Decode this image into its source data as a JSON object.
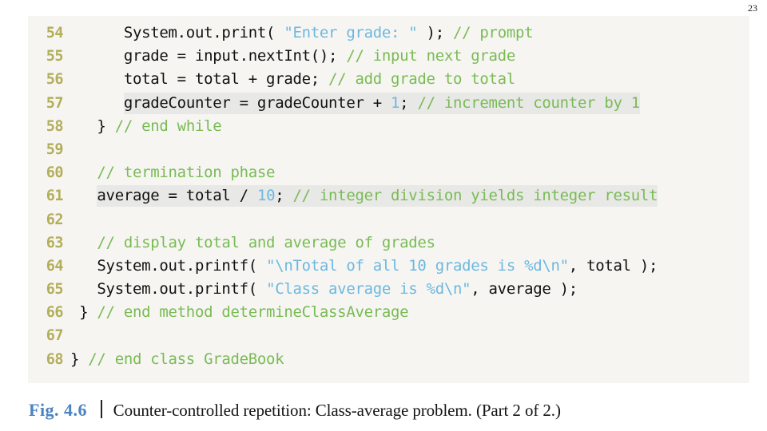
{
  "page": {
    "number": "23"
  },
  "code_listing": {
    "language": "java",
    "lines": [
      {
        "number": "54",
        "highlighted": false,
        "text": "      System.out.print( \"Enter grade: \" ); // prompt",
        "tokens": [
          {
            "type": "plain",
            "text": "      System.out.print( "
          },
          {
            "type": "string",
            "text": "\"Enter grade: \""
          },
          {
            "type": "plain",
            "text": " ); "
          },
          {
            "type": "comment",
            "text": "// prompt"
          }
        ]
      },
      {
        "number": "55",
        "highlighted": false,
        "text": "      grade = input.nextInt(); // input next grade",
        "tokens": [
          {
            "type": "plain",
            "text": "      grade = input.nextInt(); "
          },
          {
            "type": "comment",
            "text": "// input next grade"
          }
        ]
      },
      {
        "number": "56",
        "highlighted": false,
        "text": "      total = total + grade; // add grade to total",
        "tokens": [
          {
            "type": "plain",
            "text": "      total = total + grade; "
          },
          {
            "type": "comment",
            "text": "// add grade to total"
          }
        ]
      },
      {
        "number": "57",
        "highlighted": true,
        "highlight_start": 6,
        "text": "      gradeCounter = gradeCounter + 1; // increment counter by 1",
        "tokens": [
          {
            "type": "plain",
            "text": "      "
          },
          {
            "type": "plain",
            "text": "gradeCounter = gradeCounter + ",
            "hl": true
          },
          {
            "type": "number",
            "text": "1",
            "hl": true
          },
          {
            "type": "plain",
            "text": "; ",
            "hl": true
          },
          {
            "type": "comment",
            "text": "// increment counter by 1",
            "hl": true
          }
        ]
      },
      {
        "number": "58",
        "highlighted": false,
        "text": "   } // end while",
        "tokens": [
          {
            "type": "plain",
            "text": "   } "
          },
          {
            "type": "comment",
            "text": "// end while"
          }
        ]
      },
      {
        "number": "59",
        "highlighted": false,
        "text": "",
        "tokens": []
      },
      {
        "number": "60",
        "highlighted": false,
        "text": "   // termination phase",
        "tokens": [
          {
            "type": "plain",
            "text": "   "
          },
          {
            "type": "comment",
            "text": "// termination phase"
          }
        ]
      },
      {
        "number": "61",
        "highlighted": true,
        "highlight_start": 3,
        "text": "   average = total / 10; // integer division yields integer result",
        "tokens": [
          {
            "type": "plain",
            "text": "   "
          },
          {
            "type": "plain",
            "text": "average = total / ",
            "hl": true
          },
          {
            "type": "number",
            "text": "10",
            "hl": true
          },
          {
            "type": "plain",
            "text": "; ",
            "hl": true
          },
          {
            "type": "comment",
            "text": "// integer division yields integer result",
            "hl": true
          }
        ]
      },
      {
        "number": "62",
        "highlighted": false,
        "text": "",
        "tokens": []
      },
      {
        "number": "63",
        "highlighted": false,
        "text": "   // display total and average of grades",
        "tokens": [
          {
            "type": "plain",
            "text": "   "
          },
          {
            "type": "comment",
            "text": "// display total and average of grades"
          }
        ]
      },
      {
        "number": "64",
        "highlighted": false,
        "text": "   System.out.printf( \"\\nTotal of all 10 grades is %d\\n\", total );",
        "tokens": [
          {
            "type": "plain",
            "text": "   System.out.printf( "
          },
          {
            "type": "string",
            "text": "\"\\nTotal of all 10 grades is %d\\n\""
          },
          {
            "type": "plain",
            "text": ", total );"
          }
        ]
      },
      {
        "number": "65",
        "highlighted": false,
        "text": "   System.out.printf( \"Class average is %d\\n\", average );",
        "tokens": [
          {
            "type": "plain",
            "text": "   System.out.printf( "
          },
          {
            "type": "string",
            "text": "\"Class average is %d\\n\""
          },
          {
            "type": "plain",
            "text": ", average );"
          }
        ]
      },
      {
        "number": "66",
        "highlighted": false,
        "text": " } // end method determineClassAverage",
        "tokens": [
          {
            "type": "plain",
            "text": " } "
          },
          {
            "type": "comment",
            "text": "// end method determineClassAverage"
          }
        ]
      },
      {
        "number": "67",
        "highlighted": false,
        "text": "",
        "tokens": []
      },
      {
        "number": "68",
        "highlighted": false,
        "text": "} // end class GradeBook",
        "tokens": [
          {
            "type": "plain",
            "text": "} "
          },
          {
            "type": "comment",
            "text": "// end class GradeBook"
          }
        ]
      }
    ]
  },
  "caption": {
    "figure_label": "Fig. 4.6",
    "separator": "|",
    "text": "Counter-controlled repetition: Class-average problem. (Part 2 of 2.)"
  },
  "colors": {
    "line_number": "#b3ae5a",
    "comment": "#79bb54",
    "string": "#6cb8e0",
    "number_literal": "#6cb8e0",
    "code_text": "#111111",
    "code_background": "#f6f5f2",
    "highlight_background": "#e8e8e6",
    "figure_label": "#4a83c4",
    "page_background": "#ffffff"
  }
}
